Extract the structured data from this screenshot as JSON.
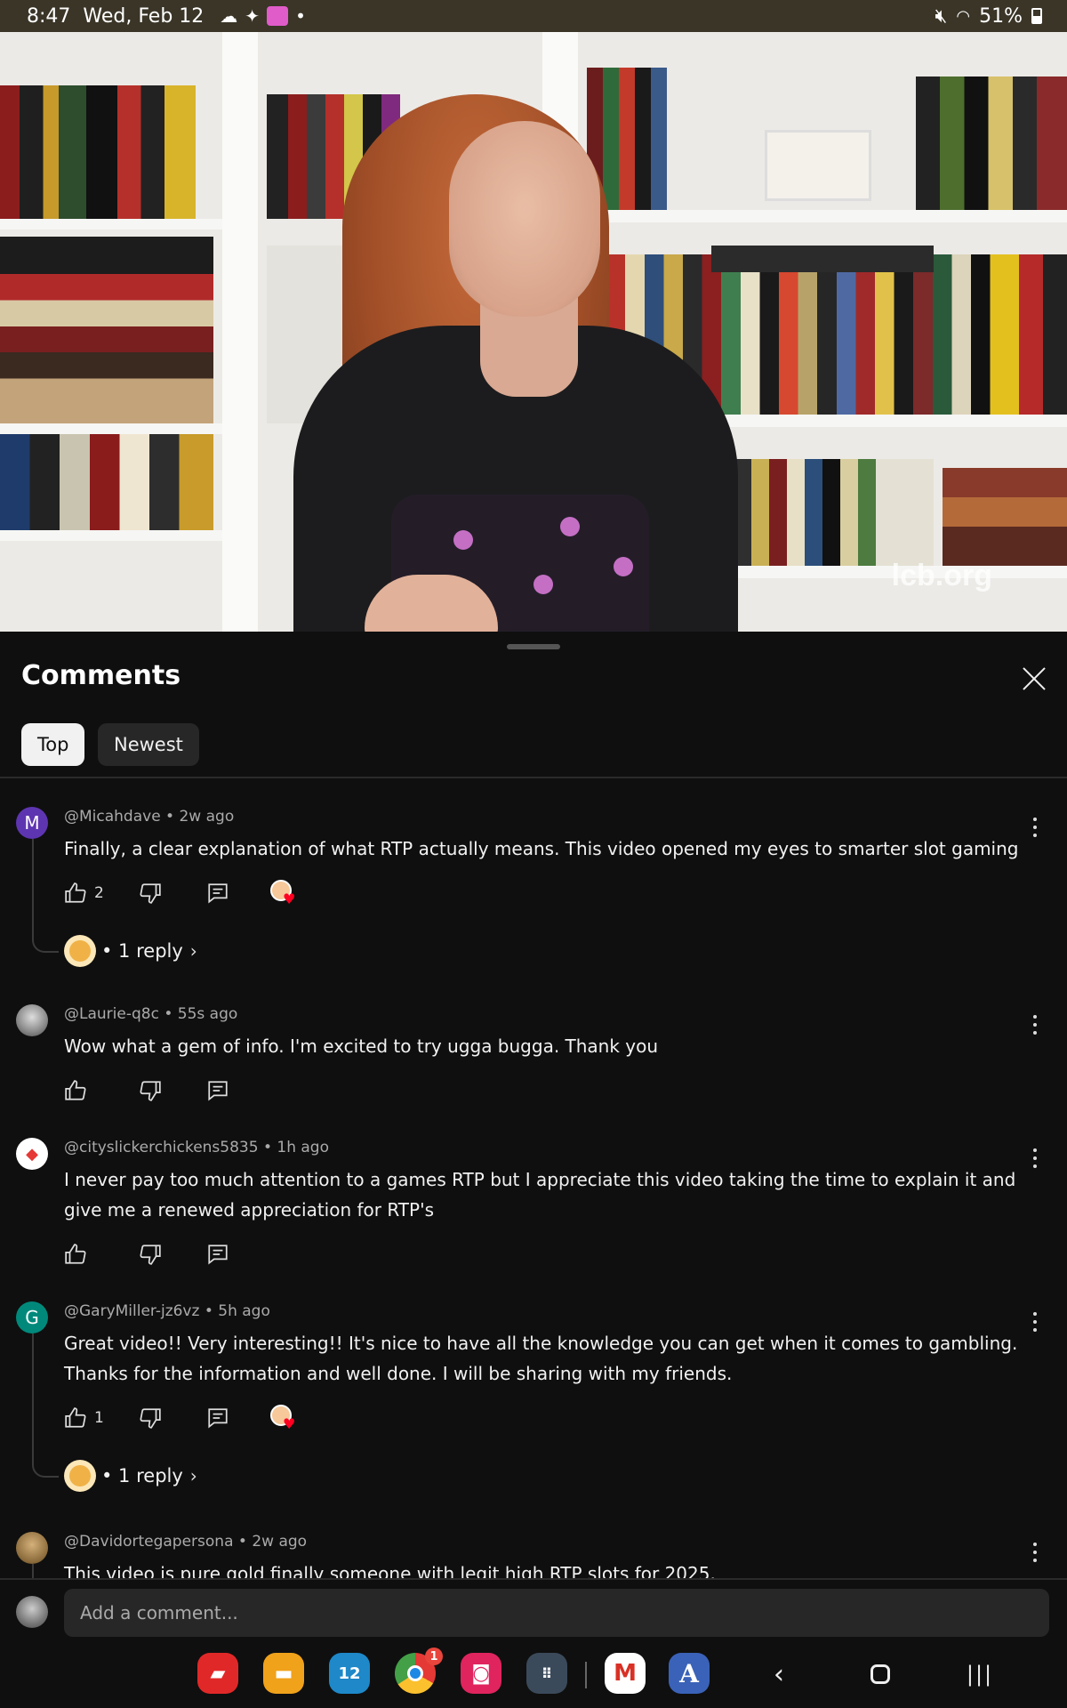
{
  "status_bar": {
    "time": "8:47",
    "date": "Wed, Feb 12",
    "battery": "51%",
    "icons": [
      "cloud-icon",
      "bird-icon",
      "app-notification-icon",
      "dot-icon",
      "mute-icon",
      "wifi-icon",
      "battery-icon"
    ]
  },
  "video": {
    "watermark": "lcb.org"
  },
  "comments_panel": {
    "title": "Comments",
    "tabs": [
      {
        "label": "Top",
        "selected": true
      },
      {
        "label": "Newest",
        "selected": false
      }
    ],
    "comments": [
      {
        "author": "@Micahdave",
        "time": "2w ago",
        "meta": "@Micahdave • 2w ago",
        "avatar_letter": "M",
        "avatar_color": "#5e35b1",
        "text": "Finally, a clear explanation of what RTP actually means. This video opened my eyes to smarter slot gaming",
        "likes": "2",
        "creator_heart": true,
        "replies": "• 1 reply"
      },
      {
        "author": "@Laurie-q8c",
        "time": "55s ago",
        "meta": "@Laurie-q8c • 55s ago",
        "avatar_letter": "",
        "avatar_color": "#888888",
        "text": "Wow what a gem of info. I'm excited to try ugga bugga. Thank you",
        "likes": "",
        "creator_heart": false,
        "replies": ""
      },
      {
        "author": "@cityslickerchickens5835",
        "time": "1h ago",
        "meta": "@cityslickerchickens5835 • 1h ago",
        "avatar_letter": "",
        "avatar_color": "#ffffff",
        "text": "I never pay too much attention to a games RTP but I appreciate this video taking the time to explain it and give me a renewed appreciation for RTP's",
        "likes": "",
        "creator_heart": false,
        "replies": ""
      },
      {
        "author": "@GaryMiller-jz6vz",
        "time": "5h ago",
        "meta": "@GaryMiller-jz6vz • 5h ago",
        "avatar_letter": "G",
        "avatar_color": "#00897b",
        "text": "Great video!! Very interesting!! It's nice to have all the knowledge you can get when it comes to gambling. Thanks for the information and well done. I will be sharing with my friends.",
        "likes": "1",
        "creator_heart": true,
        "replies": "• 1 reply"
      },
      {
        "author": "@Davidortegapersona",
        "time": "2w ago",
        "meta": "@Davidortegapersona • 2w ago",
        "avatar_letter": "",
        "avatar_color": "#b08850",
        "text": "This video is pure gold finally someone with legit high RTP slots for 2025.",
        "likes": "",
        "creator_heart": false,
        "replies": ""
      }
    ],
    "add_comment_placeholder": "Add a comment..."
  },
  "dock": {
    "apps": [
      {
        "name": "flipboard-icon",
        "color": "#e12828",
        "glyph": "▰"
      },
      {
        "name": "files-icon",
        "color": "#f0a21b",
        "glyph": "▬"
      },
      {
        "name": "calendar-icon",
        "color": "#1e88c9",
        "glyph": "12"
      },
      {
        "name": "chrome-icon",
        "color": "#4caf50",
        "glyph": "◎",
        "badge": "1"
      },
      {
        "name": "camera-icon",
        "color": "#e0245e",
        "glyph": "◙"
      },
      {
        "name": "app-drawer-icon",
        "color": "#3b4a5a",
        "glyph": "⋮⋮⋮"
      },
      {
        "name": "gmail-icon",
        "color": "#ffffff",
        "glyph": "M"
      },
      {
        "name": "app-store-icon",
        "color": "#3a62b8",
        "glyph": "A"
      }
    ]
  }
}
